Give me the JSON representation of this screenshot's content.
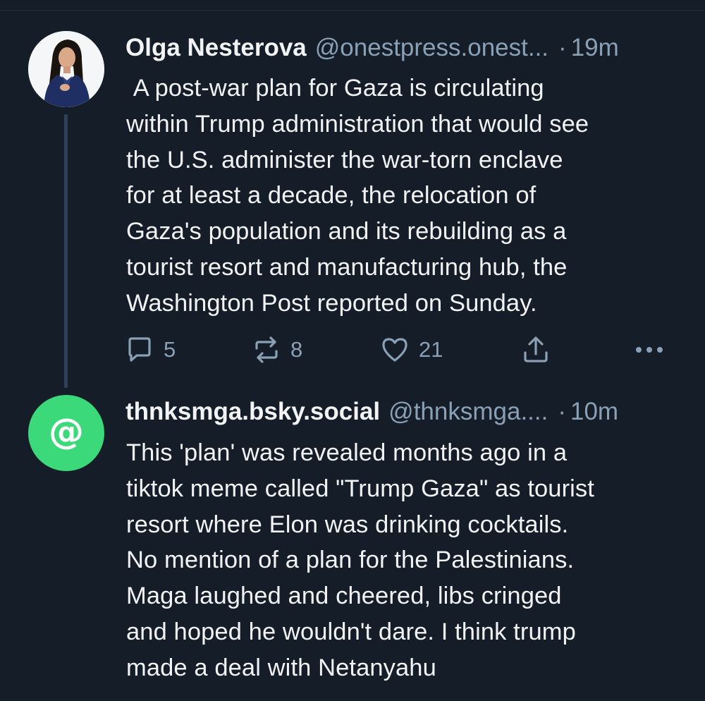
{
  "posts": [
    {
      "display_name": "Olga Nesterova",
      "handle": "@onestpress.onest...",
      "separator": "·",
      "time": "19m",
      "avatar": "profile-photo",
      "text": " A post-war plan for Gaza is circulating\nwithin Trump administration that would see\nthe U.S. administer the war-torn enclave\nfor at least a decade, the relocation of\nGaza's population and its rebuilding as a\ntourist resort and manufacturing hub, the\nWashington Post reported on Sunday.",
      "actions": {
        "reply_count": "5",
        "repost_count": "8",
        "like_count": "21"
      }
    },
    {
      "display_name": "thnksmga.bsky.social",
      "handle": "@thnksmga....",
      "separator": "·",
      "time": "10m",
      "avatar": "@",
      "avatar_color": "#3cd97a",
      "text": "This 'plan' was revealed months ago in a\ntiktok meme called \"Trump Gaza\" as tourist\nresort where Elon was drinking cocktails.\nNo mention of a plan for the Palestinians.\nMaga laughed and cheered, libs cringed\nand hoped he wouldn't dare. I think trump\nmade a deal with Netanyahu"
    }
  ],
  "colors": {
    "background": "#151d28",
    "text": "#f1f3f5",
    "muted": "#8aa0b5",
    "thread_line": "#2e4156"
  },
  "icons": [
    "reply-icon",
    "repost-icon",
    "like-icon",
    "share-icon",
    "more-icon"
  ]
}
